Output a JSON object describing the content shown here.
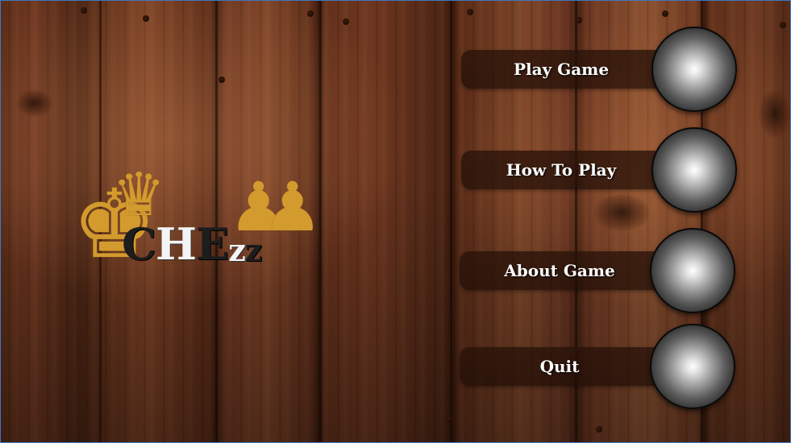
{
  "logo": {
    "word": {
      "c": "C",
      "h": "H",
      "e": "E",
      "z1": "z",
      "z2": "z"
    },
    "pieces": {
      "king": "♚",
      "queen": "♛",
      "pawn_left": "♟",
      "pawn_right": "♟"
    },
    "piece_color": "#d39a2e"
  },
  "menu": {
    "items": [
      {
        "label": "Play Game",
        "icon": "grey-orb"
      },
      {
        "label": "How To Play",
        "icon": "grey-orb"
      },
      {
        "label": "About Game",
        "icon": "grey-orb"
      },
      {
        "label": "Quit",
        "icon": "grey-orb"
      }
    ]
  },
  "colors": {
    "background": "#5a2c17",
    "menu_text": "#ffffff",
    "window_border": "#3f78c2"
  }
}
